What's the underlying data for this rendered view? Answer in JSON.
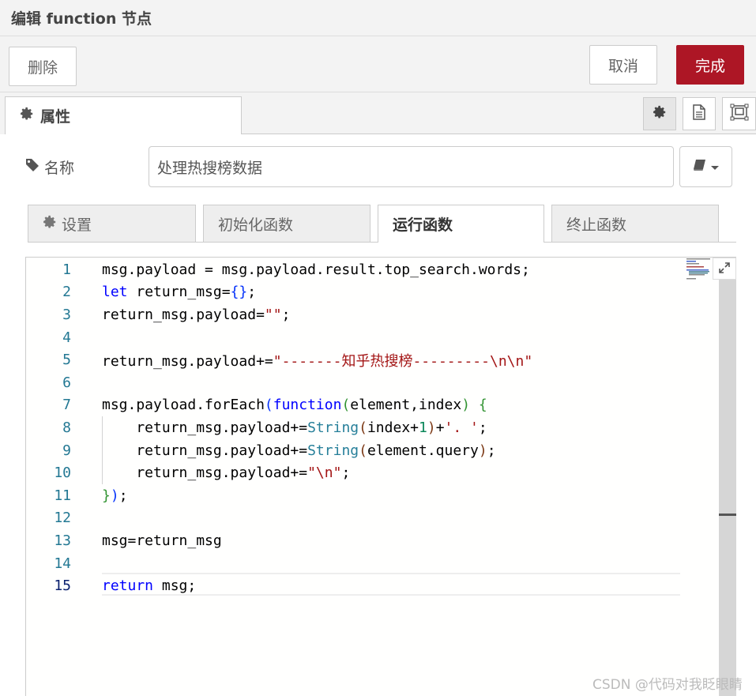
{
  "dialog": {
    "title": "编辑 function 节点"
  },
  "toolbar": {
    "delete_label": "删除",
    "cancel_label": "取消",
    "done_label": "完成"
  },
  "tabs": {
    "properties_label": "属性"
  },
  "form": {
    "name_label": "名称",
    "name_value": "处理热搜榜数据"
  },
  "subtabs": [
    {
      "label": "设置",
      "icon": "gear-icon"
    },
    {
      "label": "初始化函数"
    },
    {
      "label": "运行函数",
      "active": true
    },
    {
      "label": "终止函数"
    }
  ],
  "editor": {
    "active_line": 15,
    "line_numbers": [
      "1",
      "2",
      "3",
      "4",
      "5",
      "6",
      "7",
      "8",
      "9",
      "10",
      "11",
      "12",
      "13",
      "14",
      "15"
    ]
  },
  "colors": {
    "done_button": "#ad1625",
    "keyword": "#0000ff",
    "string": "#a31515",
    "type": "#267f99"
  },
  "watermark": "CSDN @代码对我眨眼睛"
}
